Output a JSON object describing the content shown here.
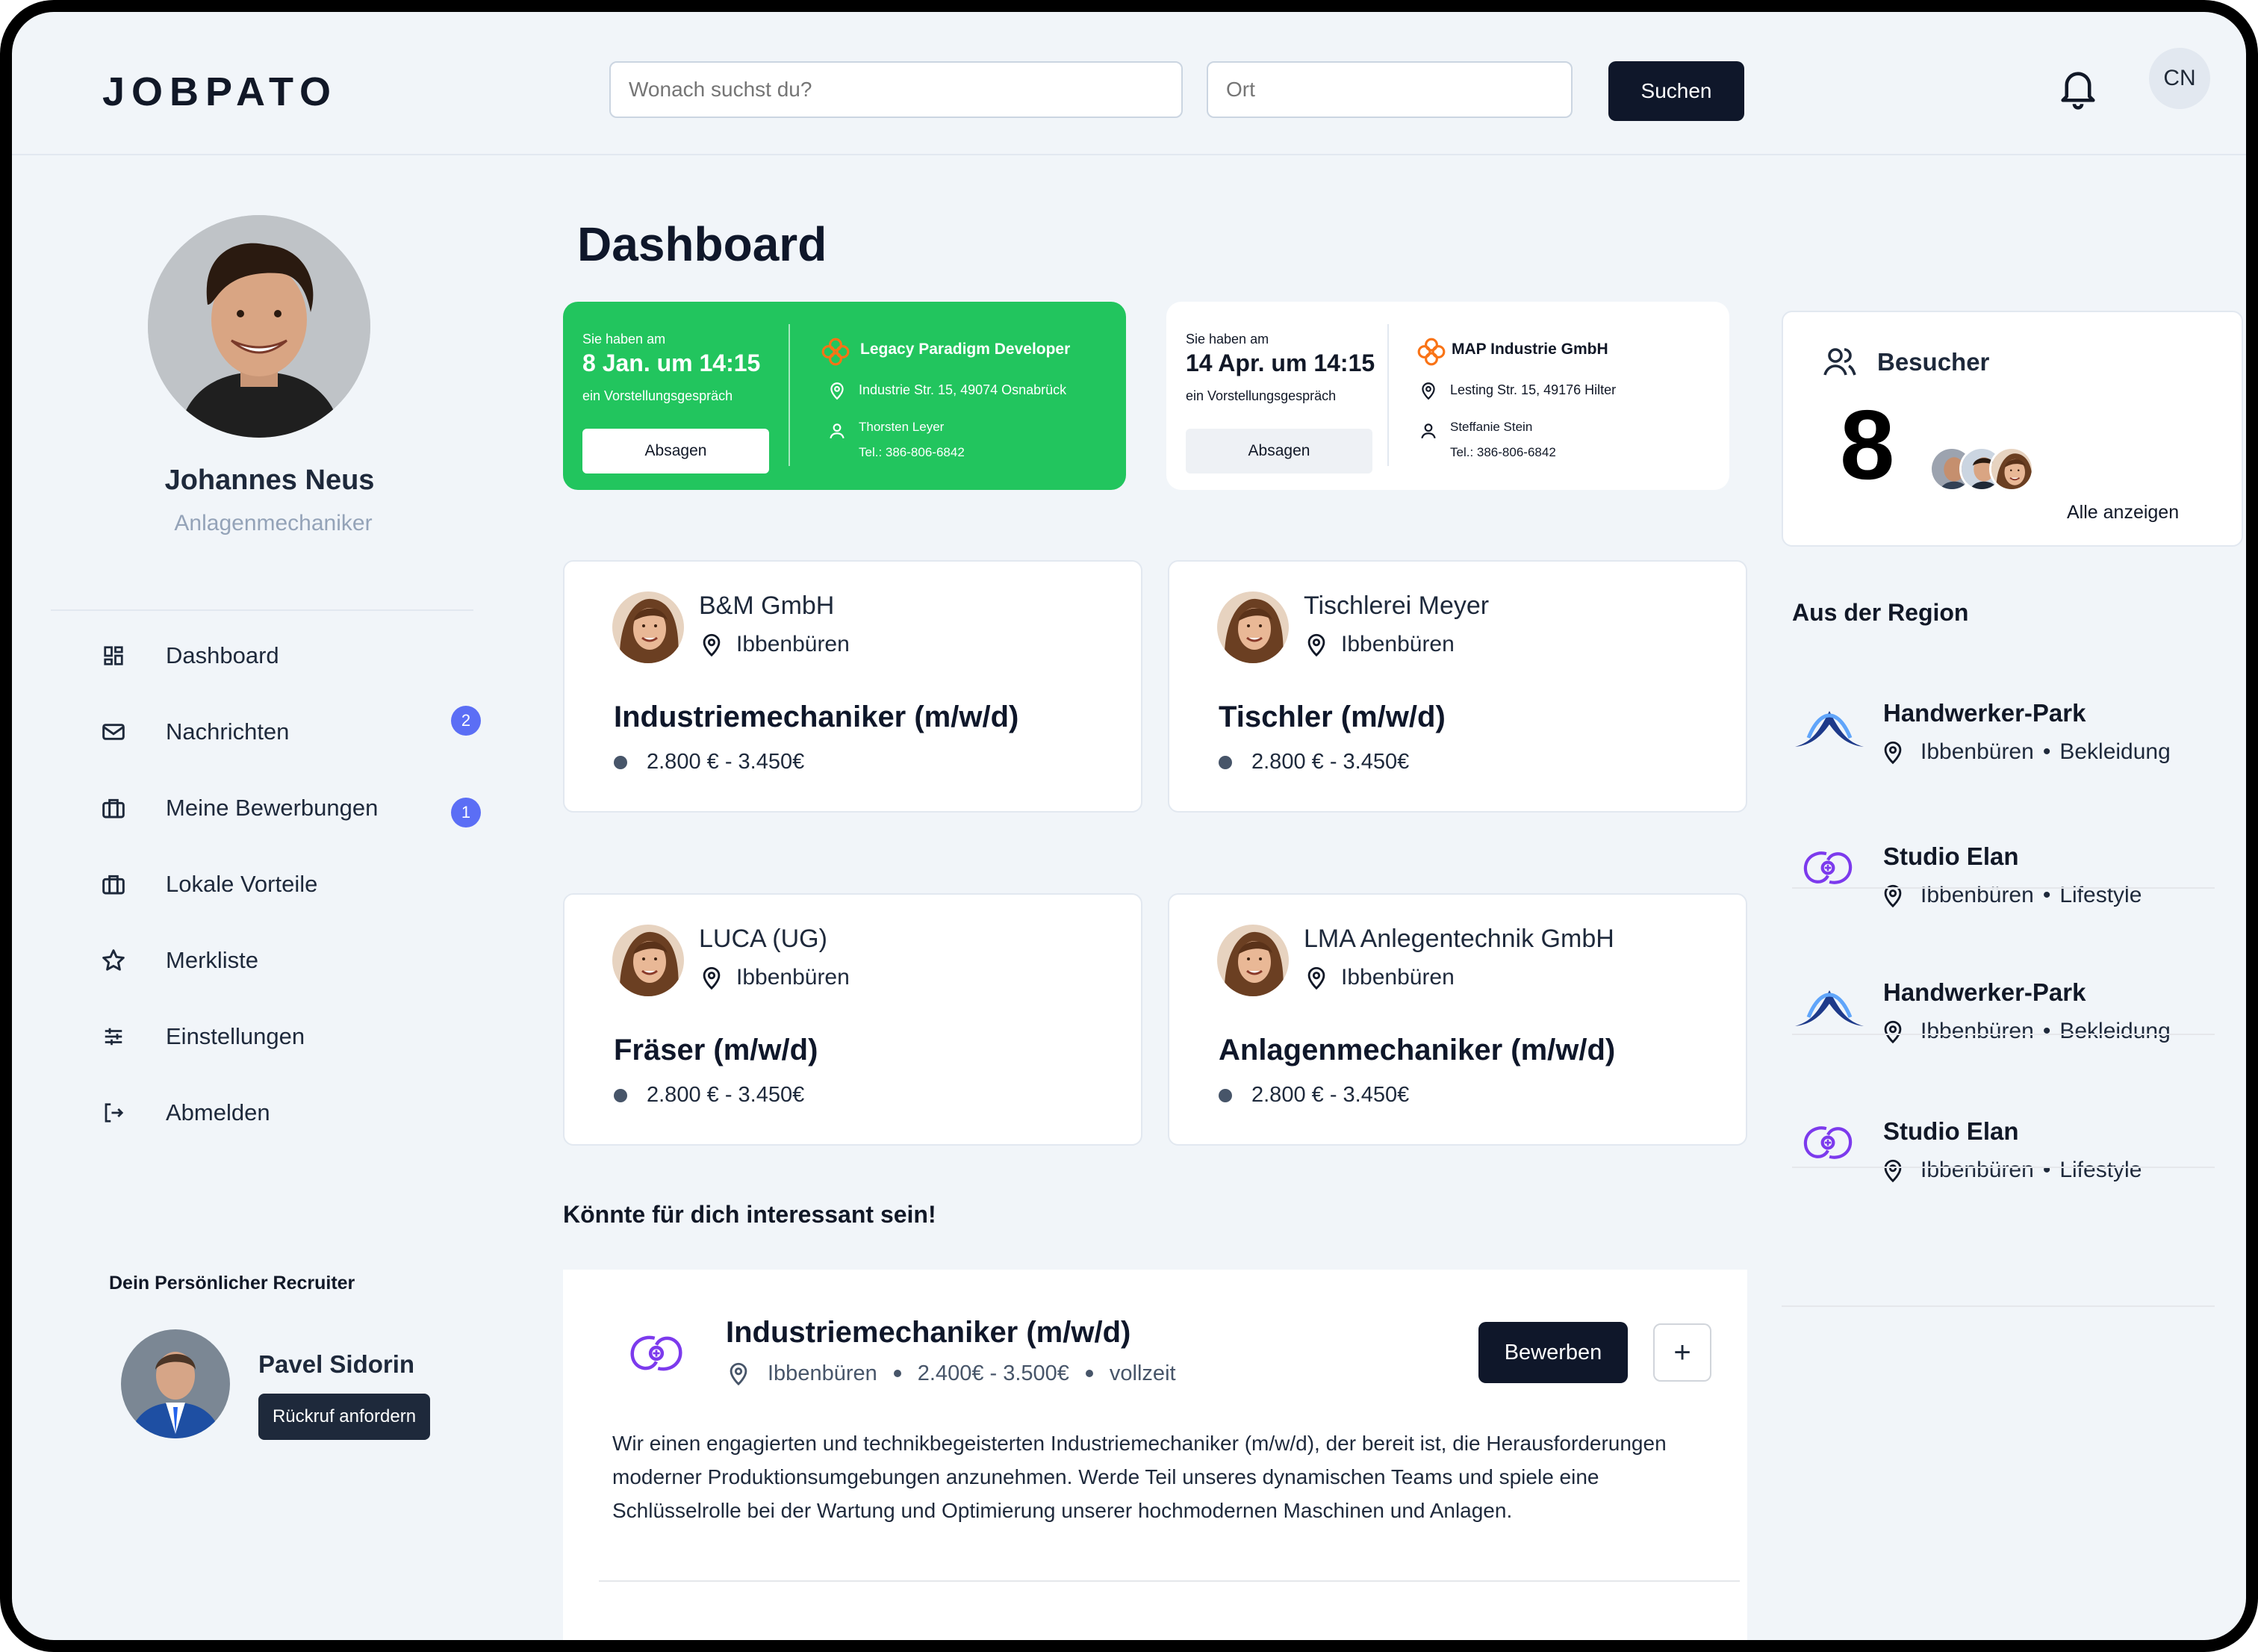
{
  "header": {
    "logo": "JOBPATO",
    "search_placeholder": "Wonach suchst du?",
    "location_placeholder": "Ort",
    "search_button": "Suchen",
    "avatar_initials": "CN"
  },
  "profile": {
    "name": "Johannes Neus",
    "role": "Anlagenmechaniker"
  },
  "sidebar": {
    "items": [
      {
        "label": "Dashboard",
        "icon": "dashboard-icon"
      },
      {
        "label": "Nachrichten",
        "icon": "mail-icon",
        "badge": "2"
      },
      {
        "label": "Meine Bewerbungen",
        "icon": "briefcase-icon",
        "badge": "1"
      },
      {
        "label": "Lokale Vorteile",
        "icon": "briefcase-icon"
      },
      {
        "label": "Merkliste",
        "icon": "star-icon"
      },
      {
        "label": "Einstellungen",
        "icon": "sliders-icon"
      },
      {
        "label": "Abmelden",
        "icon": "logout-icon"
      }
    ]
  },
  "recruiter": {
    "title": "Dein Persönlicher Recruiter",
    "name": "Pavel Sidorin",
    "button": "Rückruf anfordern"
  },
  "main": {
    "title": "Dashboard",
    "interviews": [
      {
        "intro": "Sie haben am",
        "date": "8 Jan. um 14:15",
        "subtitle": "ein Vorstellungsgespräch",
        "button": "Absagen",
        "company": "Legacy Paradigm Developer",
        "address": "Industrie Str. 15, 49074 Osnabrück",
        "contact": "Thorsten Leyer",
        "phone": "Tel.: 386-806-6842",
        "accent": "#22c55e"
      },
      {
        "intro": "Sie haben am",
        "date": "14 Apr. um 14:15",
        "subtitle": "ein Vorstellungsgespräch",
        "button": "Absagen",
        "company": "MAP Industrie GmbH",
        "address": "Lesting Str. 15, 49176 Hilter",
        "contact": "Steffanie Stein",
        "phone": "Tel.: 386-806-6842"
      }
    ],
    "jobs": [
      {
        "company": "B&M GmbH",
        "location": "Ibbenbüren",
        "title": "Industriemechaniker (m/w/d)",
        "salary": "2.800 € - 3.450€"
      },
      {
        "company": "Tischlerei Meyer",
        "location": "Ibbenbüren",
        "title": "Tischler (m/w/d)",
        "salary": "2.800 € - 3.450€"
      },
      {
        "company": "LUCA (UG)",
        "location": "Ibbenbüren",
        "title": "Fräser (m/w/d)",
        "salary": "2.800 € - 3.450€"
      },
      {
        "company": "LMA Anlegentechnik GmbH",
        "location": "Ibbenbüren",
        "title": "Anlagenmechaniker (m/w/d)",
        "salary": "2.800 € - 3.450€"
      }
    ],
    "interest_title": "Könnte für dich interessant sein!",
    "featured": {
      "title": "Industriemechaniker (m/w/d)",
      "location": "Ibbenbüren",
      "salary": "2.400€ - 3.500€",
      "type": "vollzeit",
      "apply": "Bewerben",
      "add": "+",
      "description": "Wir einen engagierten und technikbegeisterten Industriemechaniker (m/w/d), der bereit ist, die Herausforderungen moderner Produktionsumgebungen anzunehmen. Werde Teil unseres dynamischen Teams und spiele eine Schlüsselrolle bei der Wartung und Optimierung unserer hochmodernen Maschinen und Anlagen."
    }
  },
  "visitors": {
    "title": "Besucher",
    "count": "8",
    "link": "Alle anzeigen"
  },
  "region": {
    "title": "Aus der Region",
    "items": [
      {
        "name": "Handwerker-Park",
        "location": "Ibbenbüren",
        "category": "Bekleidung",
        "sep": "•",
        "logo": "park-logo"
      },
      {
        "name": "Studio Elan",
        "location": "Ibbenbüren",
        "category": "Lifestyle",
        "sep": "•",
        "logo": "elan-logo"
      },
      {
        "name": "Handwerker-Park",
        "location": "Ibbenbüren",
        "category": "Bekleidung",
        "sep": "•",
        "logo": "park-logo"
      },
      {
        "name": "Studio Elan",
        "location": "Ibbenbüren",
        "category": "Lifestyle",
        "sep": "•",
        "logo": "elan-logo"
      }
    ]
  },
  "colors": {
    "accent_green": "#22c55e",
    "dark": "#0f172a",
    "badge": "#5b6ef5",
    "bg": "#f1f5f9"
  }
}
